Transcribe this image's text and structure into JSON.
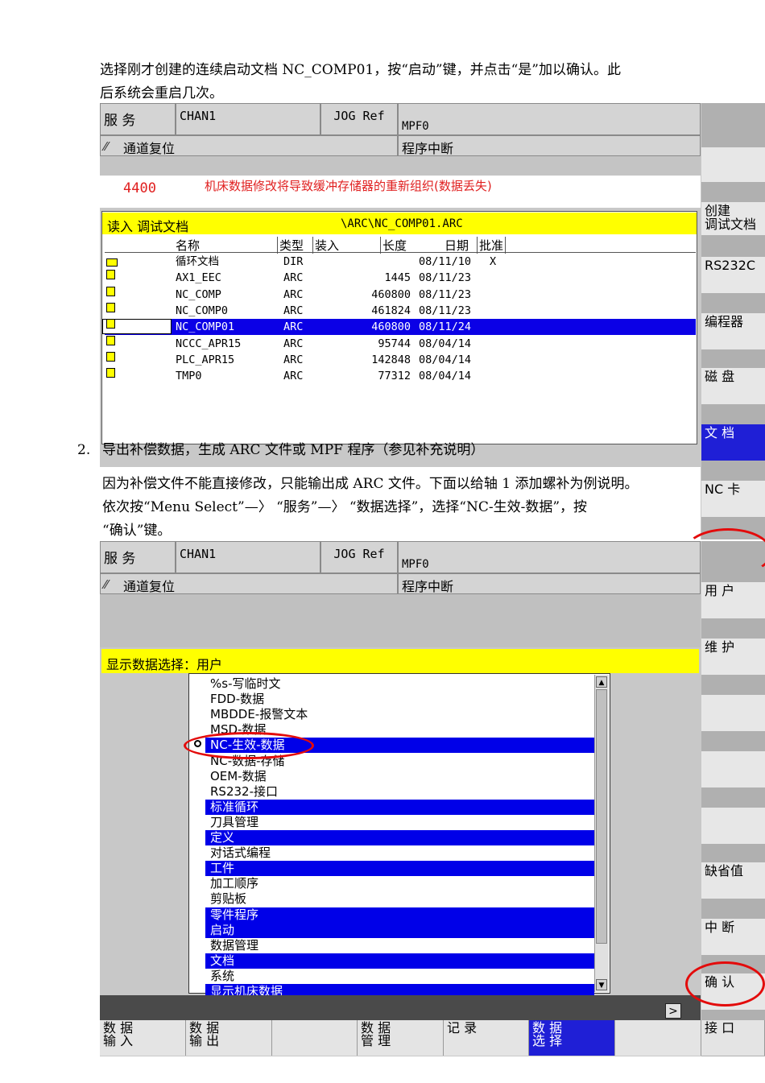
{
  "doc": {
    "para1_line1": "选择刚才创建的连续启动文档 NC_COMP01，按“启动”键，并点击“是”加以确认。此",
    "para1_line2": "后系统会重启几次。",
    "step2_number": "2.",
    "step2_line": "导出补偿数据，生成 ARC 文件或 MPF 程序（参见补充说明）",
    "para2_line1": "因为补偿文件不能直接修改，只能输出成 ARC 文件。下面以给轴 1 添加螺补为例说明。",
    "para2_line2": "依次按“Menu Select”—〉 “服务”—〉 “数据选择”，选择“NC-生效-数据”，按",
    "para2_line3": "“确认”键。"
  },
  "screen1": {
    "area": "服 务",
    "channel": "CHAN1",
    "mode": "JOG Ref",
    "program": "MPF0",
    "status_left": "通道复位",
    "status_right": "程序中断",
    "alarm_code": "4400",
    "alarm_text": "机床数据修改将导致缓冲存储器的重新组织(数据丢失)",
    "panel_title": "读入 调试文档",
    "panel_path": "\\ARC\\NC_COMP01.ARC",
    "columns": [
      "名称",
      "类型",
      "装入",
      "长度",
      "日期",
      "批准"
    ],
    "files": [
      {
        "name": "循环文档",
        "type": "DIR",
        "length": "",
        "date": "08/11/10",
        "approve": "X"
      },
      {
        "name": "AX1_EEC",
        "type": "ARC",
        "length": "1445",
        "date": "08/11/23",
        "approve": ""
      },
      {
        "name": "NC_COMP",
        "type": "ARC",
        "length": "460800",
        "date": "08/11/23",
        "approve": ""
      },
      {
        "name": "NC_COMP0",
        "type": "ARC",
        "length": "461824",
        "date": "08/11/23",
        "approve": ""
      },
      {
        "name": "NC_COMP01",
        "type": "ARC",
        "length": "460800",
        "date": "08/11/24",
        "approve": ""
      },
      {
        "name": "NCCC_APR15",
        "type": "ARC",
        "length": "95744",
        "date": "08/04/14",
        "approve": ""
      },
      {
        "name": "PLC_APR15",
        "type": "ARC",
        "length": "142848",
        "date": "08/04/14",
        "approve": ""
      },
      {
        "name": "TMP0",
        "type": "ARC",
        "length": "77312",
        "date": "08/04/14",
        "approve": ""
      }
    ],
    "selected_file_index": 4,
    "softkeys": [
      "创建\n调试文档",
      "RS232C",
      "编程器",
      "磁 盘",
      "文 档",
      "NC 卡"
    ]
  },
  "screen2": {
    "area": "服 务",
    "channel": "CHAN1",
    "mode": "JOG Ref",
    "program": "MPF0",
    "status_left": "通道复位",
    "status_right": "程序中断",
    "panel_title": "显示数据选择：用户",
    "list_items": [
      {
        "label": "%s-写临时文",
        "hl": false
      },
      {
        "label": "FDD-数据",
        "hl": false
      },
      {
        "label": "MBDDE-报警文本",
        "hl": false
      },
      {
        "label": "MSD-数据",
        "hl": false
      },
      {
        "label": "NC-生效-数据",
        "hl": true
      },
      {
        "label": "NC-数据-存储",
        "hl": false
      },
      {
        "label": "OEM-数据",
        "hl": false
      },
      {
        "label": "RS232-接口",
        "hl": false
      },
      {
        "label": "标准循环",
        "hl": true
      },
      {
        "label": "刀具管理",
        "hl": false
      },
      {
        "label": "定义",
        "hl": true
      },
      {
        "label": "对话式编程",
        "hl": false
      },
      {
        "label": "工件",
        "hl": true
      },
      {
        "label": "加工顺序",
        "hl": false
      },
      {
        "label": "剪贴板",
        "hl": false
      },
      {
        "label": "零件程序",
        "hl": true
      },
      {
        "label": "启动",
        "hl": true
      },
      {
        "label": "数据管理",
        "hl": false
      },
      {
        "label": "文档",
        "hl": true
      },
      {
        "label": "系统",
        "hl": false
      },
      {
        "label": "显示机床数据",
        "hl": true
      }
    ],
    "softkeys": [
      "用 户",
      "维 护",
      "",
      "",
      "",
      "缺省值",
      "中 断",
      "确 认"
    ],
    "bottom_keys": [
      "数 据\n输 入",
      "数 据\n输 出",
      "",
      "数 据\n管 理",
      "记 录",
      "数 据\n选 择",
      "",
      "接 口"
    ],
    "more_arrow": ">"
  },
  "colors": {
    "selection_blue": "#0b00e6",
    "title_yellow": "#ffff00",
    "circle_red": "#e30b0b"
  }
}
